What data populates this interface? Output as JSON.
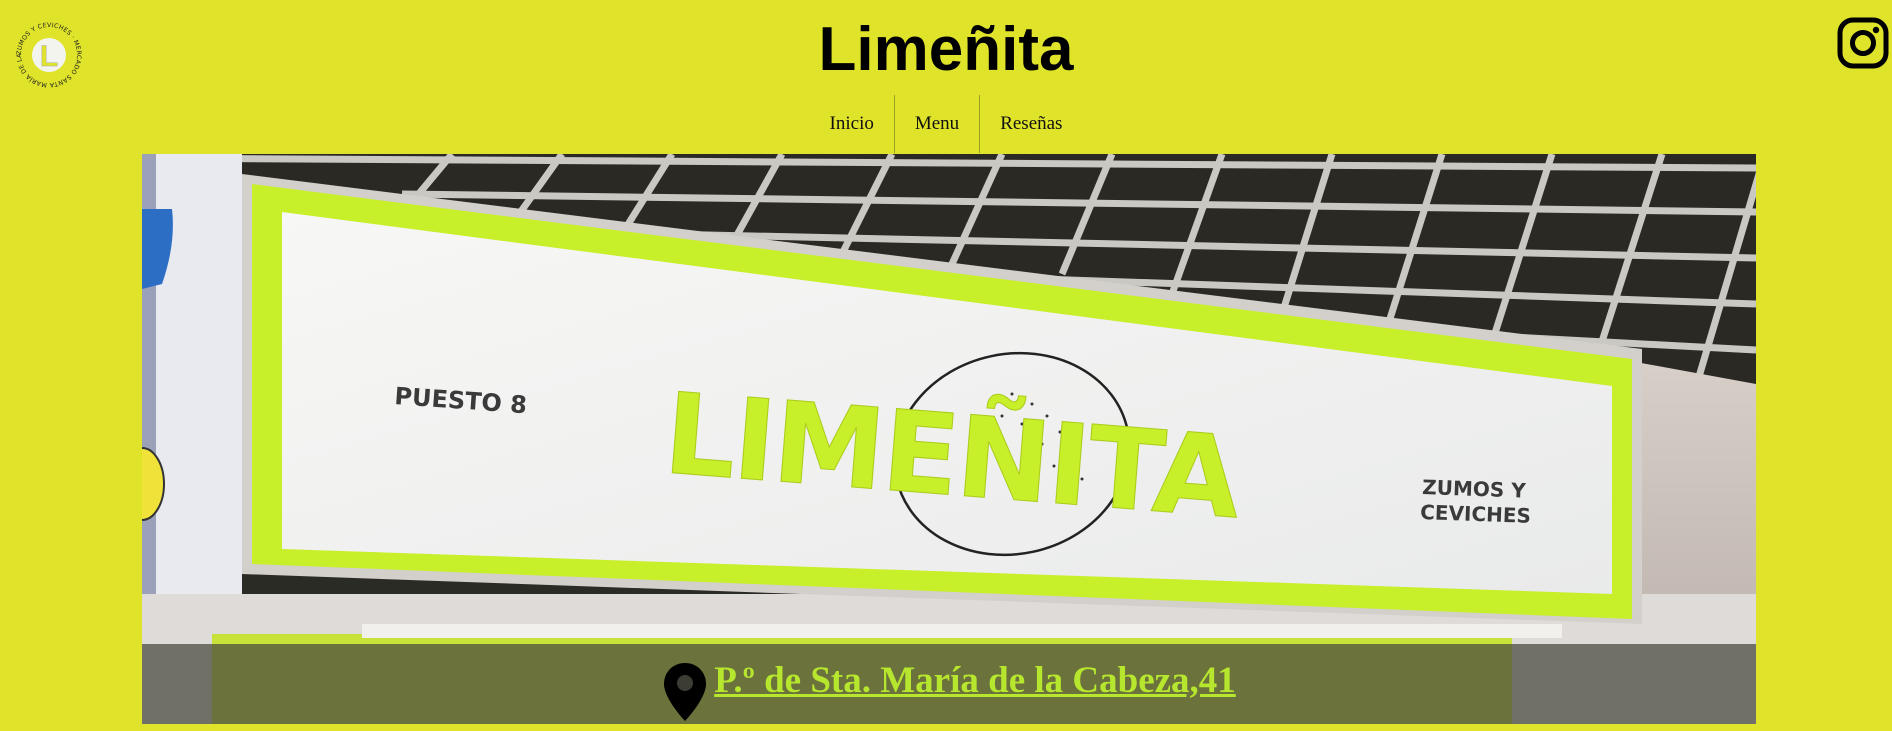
{
  "header": {
    "title": "Limeñita",
    "logo_text": "ZUMOS Y CEVICHES · MERCADO SANTA MARÍA DE LA CABEZA",
    "logo_letter": "L",
    "instagram_icon": "instagram-icon"
  },
  "nav": {
    "items": [
      {
        "label": "Inicio"
      },
      {
        "label": "Menu"
      },
      {
        "label": "Reseñas"
      }
    ]
  },
  "hero": {
    "sign_left": "PUESTO 8",
    "sign_brand": "LIMEÑITA",
    "sign_right_line1": "ZUMOS Y",
    "sign_right_line2": "CEVICHES",
    "address": "P.º de Sta. María de la Cabeza,41",
    "pin_icon": "map-pin-icon"
  },
  "colors": {
    "background": "#dfe32a",
    "accent_green": "#c7ef2a",
    "address": "#b6e62e"
  }
}
